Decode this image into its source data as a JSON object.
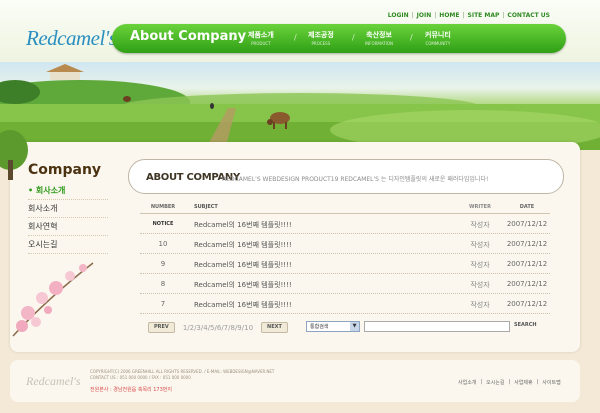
{
  "logo": {
    "brand": "Redcamel's"
  },
  "toplinks": [
    "LOGIN",
    "JOIN",
    "HOME",
    "SITE MAP",
    "CONTACT US"
  ],
  "nav": {
    "title": "About Company",
    "items": [
      {
        "ko": "제품소개",
        "en": "PRODUCT"
      },
      {
        "ko": "제조공정",
        "en": "PROCESS"
      },
      {
        "ko": "축산정보",
        "en": "INFORMATION"
      },
      {
        "ko": "커뮤니티",
        "en": "COMMUNITY"
      }
    ]
  },
  "sidebar": {
    "title": "Company",
    "items": [
      "회사소개",
      "회사소개",
      "회사연혁",
      "오시는길"
    ]
  },
  "about": {
    "heading": "ABOUT COMPANY",
    "subtitle": "REDCAMEL'S WEBDESIGN PRODUCT19   REDCAMEL'S 는 디자인템플릿의 새로운 패러다임입니다!"
  },
  "table": {
    "headers": {
      "number": "NUMBER",
      "subject": "SUBJECT",
      "writer": "WRITER",
      "date": "DATE"
    },
    "rows": [
      {
        "num": "NOTICE",
        "subject": "Redcamel의 16번째 템플릿!!!!",
        "writer": "작성자",
        "date": "2007/12/12"
      },
      {
        "num": "10",
        "subject": "Redcamel의 16번째 템플릿!!!!",
        "writer": "작성자",
        "date": "2007/12/12"
      },
      {
        "num": "9",
        "subject": "Redcamel의 16번째 템플릿!!!!",
        "writer": "작성자",
        "date": "2007/12/12"
      },
      {
        "num": "8",
        "subject": "Redcamel의 16번째 템플릿!!!!",
        "writer": "작성자",
        "date": "2007/12/12"
      },
      {
        "num": "7",
        "subject": "Redcamel의 16번째 템플릿!!!!",
        "writer": "작성자",
        "date": "2007/12/12"
      }
    ]
  },
  "pager": {
    "prev": "PREV",
    "pages": "1/2/3/4/5/6/7/8/9/10",
    "next": "NEXT"
  },
  "search": {
    "select": "통합검색",
    "button": "SEARCH"
  },
  "footer": {
    "logo": "Redcamel's",
    "copyright": "COPYRIGHT(C) 2006 GREENHILL ALL RIGHTS RESERVED. / E-MAIL: WEBDESIGN@NAVER.NET",
    "contact": "CONTACT US : 051 000 0000 / FAX : 051 000 0000",
    "address": "전원본사 : 경남전원읍 축목리 173번지",
    "links": [
      "사업소개",
      "오시는길",
      "사업제휴",
      "사이트맵"
    ]
  }
}
